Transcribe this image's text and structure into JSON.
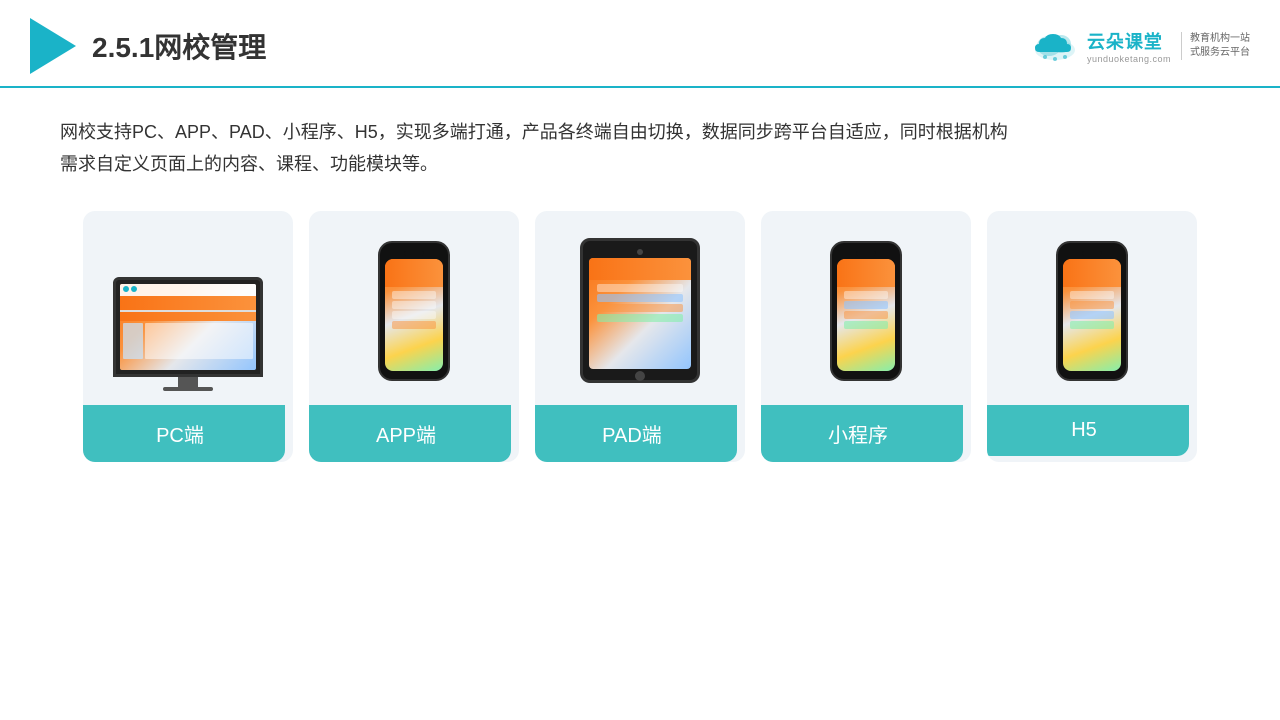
{
  "header": {
    "title": "2.5.1网校管理",
    "brand": {
      "name": "云朵课堂",
      "url": "yunduoketang.com",
      "tagline": "教育机构一站\n式服务云平台"
    }
  },
  "description": "网校支持PC、APP、PAD、小程序、H5，实现多端打通，产品各终端自由切换，数据同步跨平台自适应，同时根据机构\n需求自定义页面上的内容、课程、功能模块等。",
  "cards": [
    {
      "id": "pc",
      "label": "PC端",
      "type": "pc"
    },
    {
      "id": "app",
      "label": "APP端",
      "type": "phone"
    },
    {
      "id": "pad",
      "label": "PAD端",
      "type": "tablet"
    },
    {
      "id": "miniapp",
      "label": "小程序",
      "type": "phone"
    },
    {
      "id": "h5",
      "label": "H5",
      "type": "phone"
    }
  ],
  "accent_color": "#40bfbf",
  "header_border_color": "#1ab3c8"
}
